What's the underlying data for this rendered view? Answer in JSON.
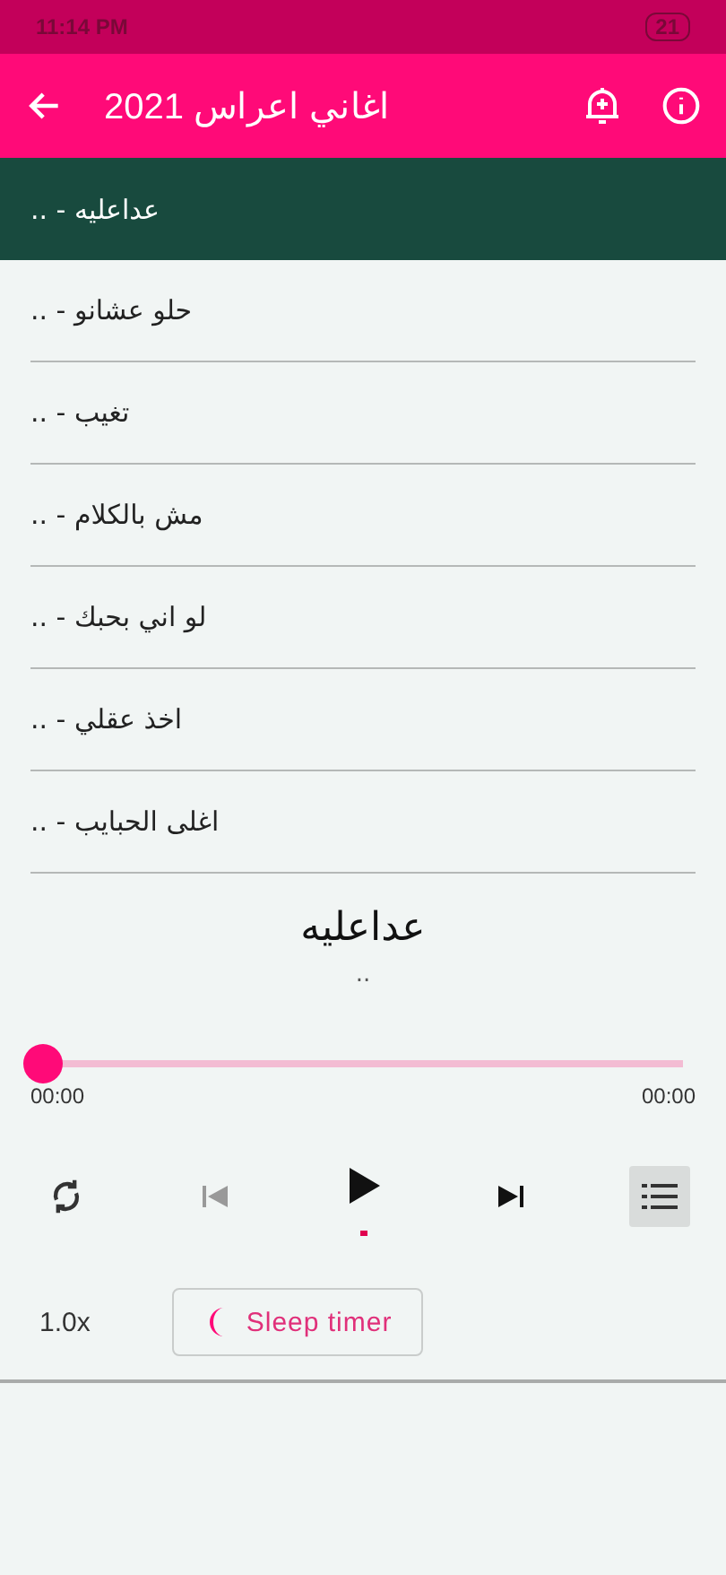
{
  "status_bar": {
    "time": "11:14 PM",
    "battery": "21"
  },
  "app_bar": {
    "title": "اغاني اعراس 2021"
  },
  "tracks": [
    {
      "label": ".. - عداعليه",
      "selected": true
    },
    {
      "label": ".. - حلو عشانو",
      "selected": false
    },
    {
      "label": ".. - تغيب",
      "selected": false
    },
    {
      "label": ".. - مش بالكلام",
      "selected": false
    },
    {
      "label": ".. - لو اني بحبك",
      "selected": false
    },
    {
      "label": ".. - اخذ عقلي",
      "selected": false
    },
    {
      "label": ".. - اغلى الحبايب",
      "selected": false
    }
  ],
  "now_playing": {
    "title": "عداعليه",
    "artist": ".."
  },
  "progress": {
    "level": 0,
    "elapsed": "00:00",
    "duration": "00:00"
  },
  "controls": {
    "previous_disabled": true,
    "playlist_on": true
  },
  "speed": "1.0x",
  "sleep_timer": "Sleep timer"
}
